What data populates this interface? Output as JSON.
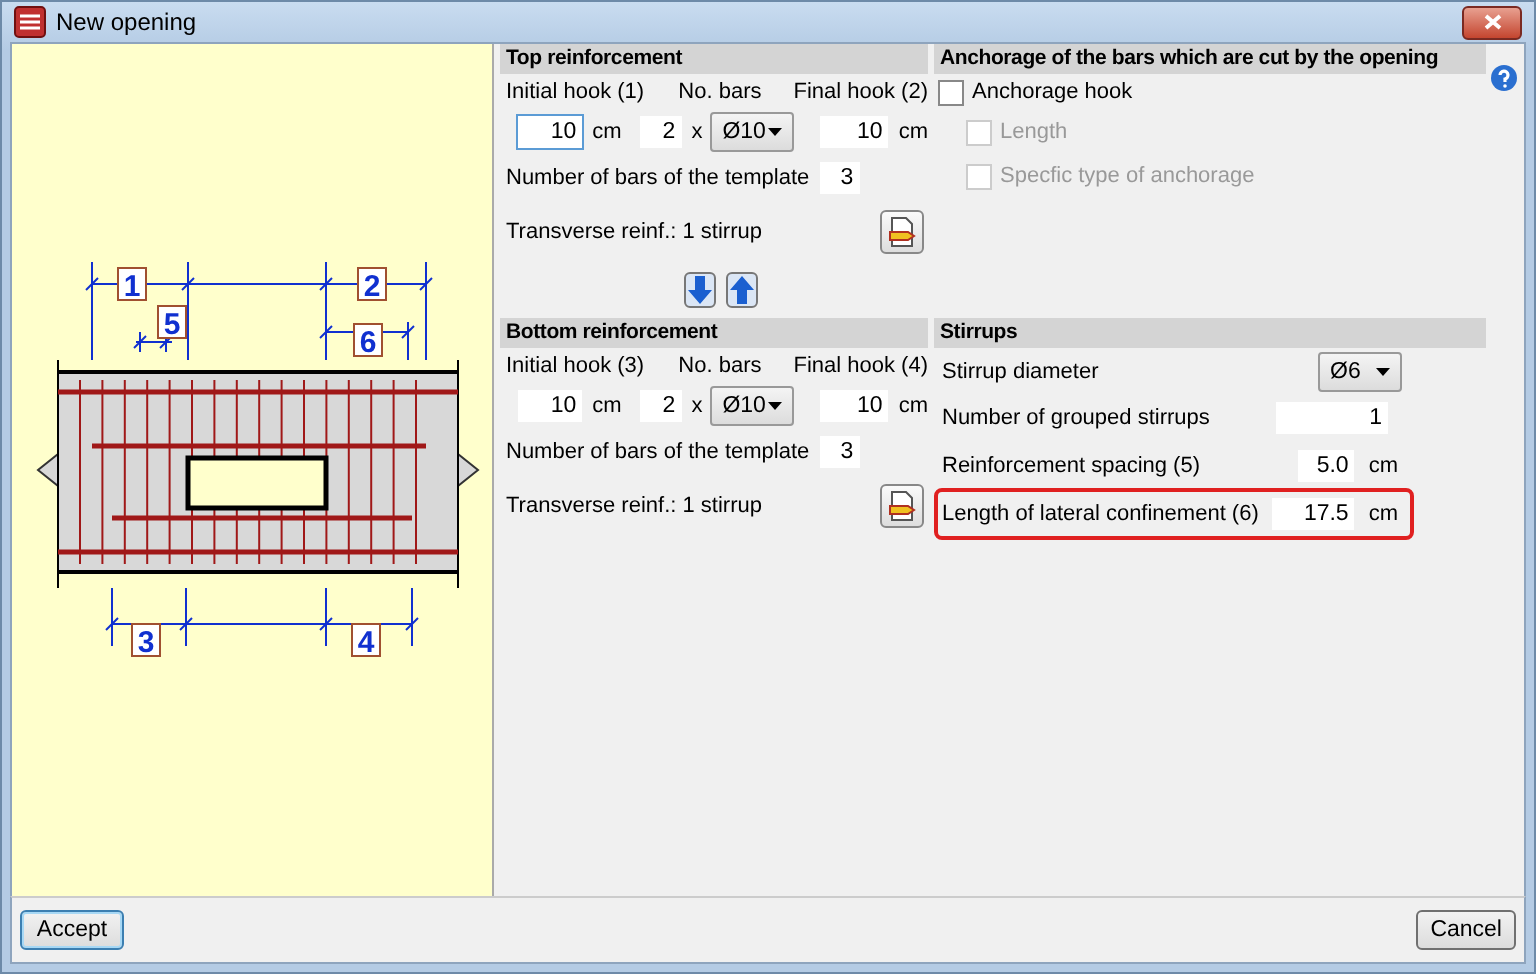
{
  "window": {
    "title": "New opening"
  },
  "diagram_labels": [
    "1",
    "2",
    "5",
    "6",
    "3",
    "4"
  ],
  "top": {
    "title": "Top reinforcement",
    "initial_label": "Initial hook (1)",
    "bars_label": "No. bars",
    "final_label": "Final hook (2)",
    "initial": "10",
    "initial_focused": true,
    "unit": "cm",
    "count": "2",
    "times": "x",
    "diameter": "Ø10",
    "final": "10",
    "final_unit": "cm",
    "template_label": "Number of bars of the template",
    "template_value": "3",
    "transverse_label": "Transverse reinf.: 1 stirrup"
  },
  "bottom": {
    "title": "Bottom reinforcement",
    "initial_label": "Initial hook (3)",
    "bars_label": "No. bars",
    "final_label": "Final hook (4)",
    "initial": "10",
    "initial_focused": false,
    "unit": "cm",
    "count": "2",
    "times": "x",
    "diameter": "Ø10",
    "final": "10",
    "final_unit": "cm",
    "template_label": "Number of bars of the template",
    "template_value": "3",
    "transverse_label": "Transverse reinf.: 1 stirrup"
  },
  "anchorage": {
    "title": "Anchorage of the bars which are cut by the opening",
    "options": [
      {
        "label": "Anchorage hook",
        "checked": false,
        "disabled": false
      },
      {
        "label": "Length",
        "checked": false,
        "disabled": true
      },
      {
        "label": "Specfic type of anchorage",
        "checked": false,
        "disabled": true
      }
    ]
  },
  "stirrups": {
    "title": "Stirrups",
    "rows": [
      {
        "kind": "select",
        "label": "Stirrup diameter",
        "value": "Ø6",
        "highlighted": false
      },
      {
        "kind": "input",
        "label": "Number of grouped stirrups",
        "value": "1",
        "highlighted": false
      },
      {
        "kind": "unit",
        "label": "Reinforcement spacing (5)",
        "value": "5.0",
        "unit": "cm",
        "highlighted": false
      },
      {
        "kind": "unit",
        "label": "Length of lateral confinement (6)",
        "value": "17.5",
        "unit": "cm",
        "highlighted": true
      }
    ]
  },
  "buttons": [
    {
      "label": "Accept",
      "default": true
    },
    {
      "label": "Cancel",
      "default": false
    }
  ]
}
